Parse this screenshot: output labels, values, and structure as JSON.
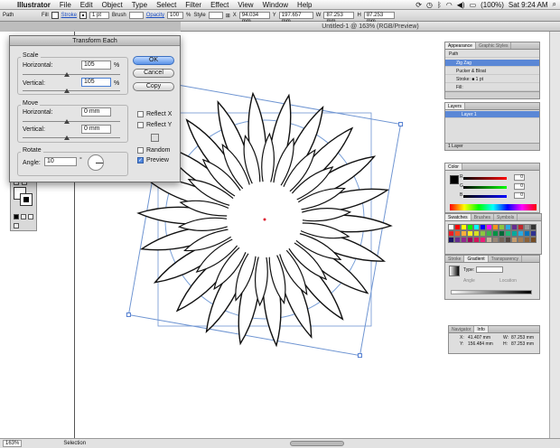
{
  "menubar": {
    "app": "Illustrator",
    "items": [
      "File",
      "Edit",
      "Object",
      "Type",
      "Select",
      "Filter",
      "Effect",
      "View",
      "Window",
      "Help"
    ],
    "battery": "(100%)",
    "clock": "Sat 9:24 AM"
  },
  "control": {
    "selection_type": "Path",
    "fill_label": "Fill",
    "stroke_label": "Stroke",
    "stroke_weight": "1 pt",
    "brush_label": "Brush",
    "opacity_label": "Opacity",
    "opacity_value": "100",
    "opacity_unit": "%",
    "style_label": "Style",
    "x_label": "X",
    "x_value": "94.034 mm",
    "y_label": "Y",
    "y_value": "197.657 mm",
    "w_label": "W",
    "w_value": "87.253 mm",
    "h_label": "H",
    "h_value": "87.253 mm"
  },
  "document": {
    "title": "Untitled-1 @ 163% (RGB/Preview)"
  },
  "status": {
    "zoom": "163%",
    "tool": "Selection"
  },
  "dialog": {
    "title": "Transform Each",
    "scale_group": "Scale",
    "scale_h_label": "Horizontal:",
    "scale_h_value": "105",
    "scale_v_label": "Vertical:",
    "scale_v_value": "105",
    "percent": "%",
    "move_group": "Move",
    "move_h_label": "Horizontal:",
    "move_h_value": "0 mm",
    "move_v_label": "Vertical:",
    "move_v_value": "0 mm",
    "rotate_group": "Rotate",
    "angle_label": "Angle:",
    "angle_value": "10",
    "degree": "°",
    "ok": "OK",
    "cancel": "Cancel",
    "copy": "Copy",
    "reflect_x": "Reflect X",
    "reflect_y": "Reflect Y",
    "random": "Random",
    "preview": "Preview",
    "preview_checked": true
  },
  "appearance": {
    "tabs": [
      "Appearance",
      "Graphic Styles"
    ],
    "rows": [
      "Path",
      "Zig Zag",
      "Pucker & Bloat",
      "Stroke:",
      "1 pt",
      "Fill:"
    ]
  },
  "layers": {
    "tab": "Layers",
    "row": "Layer 1",
    "footer": "1 Layer"
  },
  "color": {
    "tab": "Color",
    "channels": [
      {
        "label": "R",
        "value": "0"
      },
      {
        "label": "G",
        "value": "0"
      },
      {
        "label": "B",
        "value": "0"
      }
    ]
  },
  "swatches": {
    "tabs": [
      "Swatches",
      "Brushes",
      "Symbols"
    ],
    "colors": [
      "#ffffff",
      "#ff0000",
      "#ffff00",
      "#00ff00",
      "#00ffff",
      "#0000ff",
      "#ff00ff",
      "#f7931e",
      "#8cc63f",
      "#29abe2",
      "#662d91",
      "#c1272d",
      "#999999",
      "#333333",
      "#ed1c24",
      "#f15a24",
      "#fbb03b",
      "#fcee21",
      "#d9e021",
      "#8cc63f",
      "#39b54a",
      "#009245",
      "#006837",
      "#22b573",
      "#00a99d",
      "#29abe2",
      "#0071bc",
      "#2e3192",
      "#1b1464",
      "#662d91",
      "#93278f",
      "#9e005d",
      "#d4145a",
      "#ed1e79",
      "#c7b299",
      "#998675",
      "#736357",
      "#534741",
      "#c69c6d",
      "#a67c52",
      "#8c6239",
      "#754c24"
    ]
  },
  "gradient": {
    "tabs": [
      "Stroke",
      "Gradient",
      "Transparency"
    ],
    "type_label": "Type:",
    "angle_label": "Angle",
    "location_label": "Location"
  },
  "info": {
    "tabs": [
      "Navigator",
      "Info"
    ],
    "x_label": "X:",
    "x_value": "41.407 mm",
    "y_label": "Y:",
    "y_value": "156.484 mm",
    "w_label": "W:",
    "w_value": "87.253 mm",
    "h_label": "H:",
    "h_value": "87.253 mm"
  }
}
